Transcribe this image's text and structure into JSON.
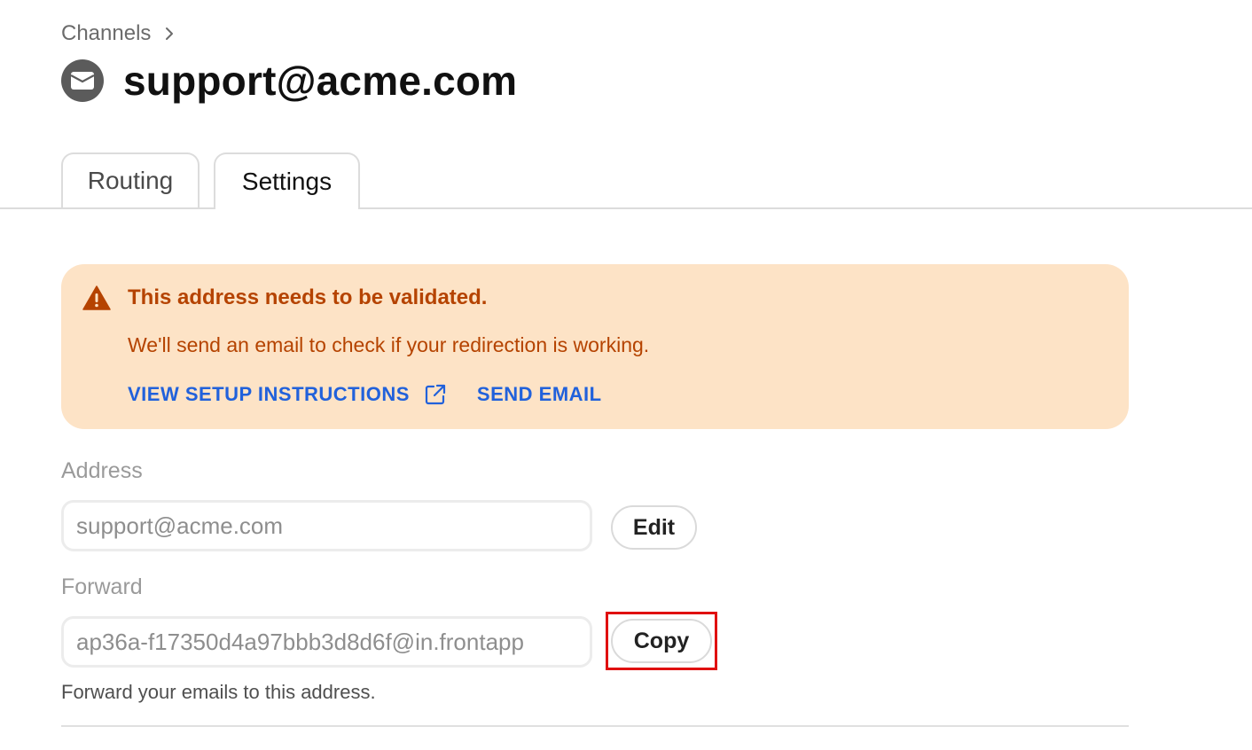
{
  "breadcrumb": {
    "parent": "Channels"
  },
  "header": {
    "title": "support@acme.com"
  },
  "tabs": [
    {
      "label": "Routing",
      "active": false
    },
    {
      "label": "Settings",
      "active": true
    }
  ],
  "banner": {
    "headline": "This address needs to be validated.",
    "message": "We'll send an email to check if your redirection is working.",
    "setup_link": "VIEW SETUP INSTRUCTIONS",
    "send_link": "SEND EMAIL",
    "colors": {
      "background": "#fde3c6",
      "text": "#b54300",
      "link": "#2161db"
    }
  },
  "address": {
    "label": "Address",
    "value": "support@acme.com",
    "edit_label": "Edit"
  },
  "forward": {
    "label": "Forward",
    "value": "ap36a-f17350d4a97bbb3d8d6f@in.frontapp",
    "copy_label": "Copy",
    "hint": "Forward your emails to this address."
  },
  "icons": {
    "breadcrumb_separator": "chevron-right-icon",
    "channel": "envelope-icon",
    "warning": "warning-triangle-icon",
    "external": "external-link-icon"
  }
}
